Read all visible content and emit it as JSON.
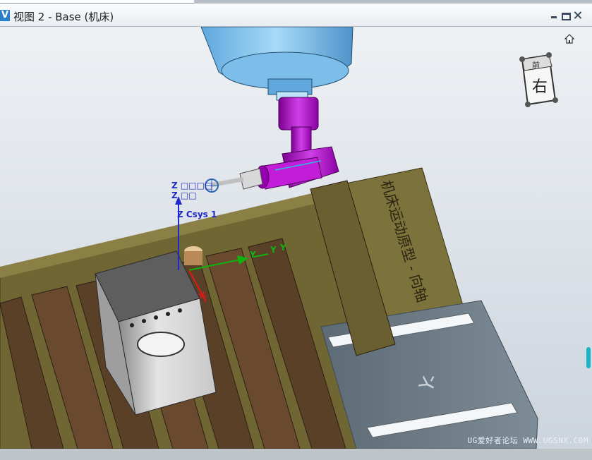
{
  "window": {
    "app_icon_letter": "V",
    "title": "视图 2 - Base (机床)"
  },
  "viewport": {
    "axis_labels": {
      "tool_z_top": "Z □□□□",
      "tool_z_bottom": "Z □□",
      "csys_z": "Z Csys 1",
      "csys_y": "Y",
      "y_second": "Y",
      "y_third": "Y",
      "csys_x": "X"
    },
    "part_side_label": "机床运动原型 - 向轴",
    "y_rail_label": "Y-",
    "nav_cube_face": "右",
    "nav_cube_top": "前"
  },
  "watermark": "UG爱好者论坛 WWW.UGSNX.COM",
  "colors": {
    "titlebar_bg": "#f2f4f7",
    "viewport_bg_top": "#e9edf1",
    "viewport_bg_bottom": "#cfd6de",
    "spindle": "#8ec7ef",
    "tool_head": "#a000c0",
    "table_base": "#6b6130",
    "table_slot": "#5a3f27",
    "rail_gray": "#6f7e89",
    "axis_z": "#1f29c8",
    "axis_y": "#10b210",
    "axis_x": "#e01818"
  }
}
